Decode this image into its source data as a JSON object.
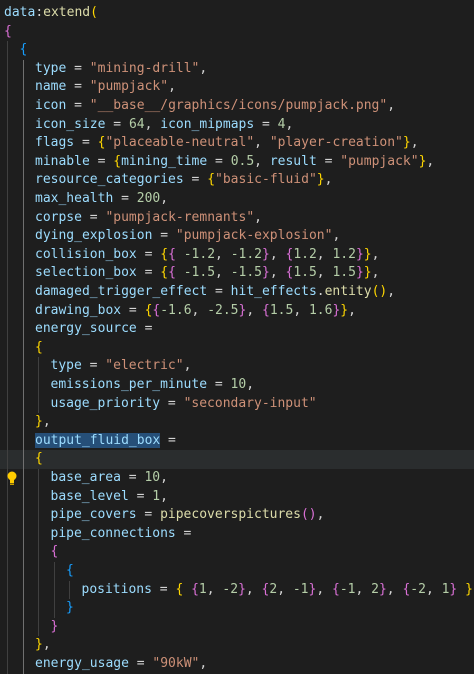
{
  "editor": {
    "theme": {
      "background": "#1e1e1e",
      "fn": "#dcdcaa",
      "var": "#9cdcfe",
      "str": "#ce9178",
      "num": "#b5cea8",
      "gold": "#ffd700",
      "pink": "#da70d6",
      "blue": "#179fff"
    },
    "highlighted_line": 24,
    "selected_word": "output_fluid_box",
    "lightbulb_line": 25,
    "lines": [
      {
        "indent": 0,
        "tokens": [
          [
            "var",
            "data"
          ],
          [
            "op",
            ":"
          ],
          [
            "fn",
            "extend"
          ],
          [
            "b1",
            "("
          ]
        ]
      },
      {
        "indent": 0,
        "tokens": [
          [
            "b2",
            "{"
          ]
        ]
      },
      {
        "indent": 1,
        "tokens": [
          [
            "b3",
            "{"
          ]
        ]
      },
      {
        "indent": 2,
        "tokens": [
          [
            "var",
            "type"
          ],
          [
            "op",
            " = "
          ],
          [
            "str",
            "\"mining-drill\""
          ],
          [
            "op",
            ","
          ]
        ]
      },
      {
        "indent": 2,
        "tokens": [
          [
            "var",
            "name"
          ],
          [
            "op",
            " = "
          ],
          [
            "str",
            "\"pumpjack\""
          ],
          [
            "op",
            ","
          ]
        ]
      },
      {
        "indent": 2,
        "tokens": [
          [
            "var",
            "icon"
          ],
          [
            "op",
            " = "
          ],
          [
            "str",
            "\"__base__/graphics/icons/pumpjack.png\""
          ],
          [
            "op",
            ","
          ]
        ]
      },
      {
        "indent": 2,
        "tokens": [
          [
            "var",
            "icon_size"
          ],
          [
            "op",
            " = "
          ],
          [
            "num",
            "64"
          ],
          [
            "op",
            ", "
          ],
          [
            "var",
            "icon_mipmaps"
          ],
          [
            "op",
            " = "
          ],
          [
            "num",
            "4"
          ],
          [
            "op",
            ","
          ]
        ]
      },
      {
        "indent": 2,
        "tokens": [
          [
            "var",
            "flags"
          ],
          [
            "op",
            " = "
          ],
          [
            "b1",
            "{"
          ],
          [
            "str",
            "\"placeable-neutral\""
          ],
          [
            "op",
            ", "
          ],
          [
            "str",
            "\"player-creation\""
          ],
          [
            "b1",
            "}"
          ],
          [
            "op",
            ","
          ]
        ]
      },
      {
        "indent": 2,
        "tokens": [
          [
            "var",
            "minable"
          ],
          [
            "op",
            " = "
          ],
          [
            "b1",
            "{"
          ],
          [
            "var",
            "mining_time"
          ],
          [
            "op",
            " = "
          ],
          [
            "num",
            "0.5"
          ],
          [
            "op",
            ", "
          ],
          [
            "var",
            "result"
          ],
          [
            "op",
            " = "
          ],
          [
            "str",
            "\"pumpjack\""
          ],
          [
            "b1",
            "}"
          ],
          [
            "op",
            ","
          ]
        ]
      },
      {
        "indent": 2,
        "tokens": [
          [
            "var",
            "resource_categories"
          ],
          [
            "op",
            " = "
          ],
          [
            "b1",
            "{"
          ],
          [
            "str",
            "\"basic-fluid\""
          ],
          [
            "b1",
            "}"
          ],
          [
            "op",
            ","
          ]
        ]
      },
      {
        "indent": 2,
        "tokens": [
          [
            "var",
            "max_health"
          ],
          [
            "op",
            " = "
          ],
          [
            "num",
            "200"
          ],
          [
            "op",
            ","
          ]
        ]
      },
      {
        "indent": 2,
        "tokens": [
          [
            "var",
            "corpse"
          ],
          [
            "op",
            " = "
          ],
          [
            "str",
            "\"pumpjack-remnants\""
          ],
          [
            "op",
            ","
          ]
        ]
      },
      {
        "indent": 2,
        "tokens": [
          [
            "var",
            "dying_explosion"
          ],
          [
            "op",
            " = "
          ],
          [
            "str",
            "\"pumpjack-explosion\""
          ],
          [
            "op",
            ","
          ]
        ]
      },
      {
        "indent": 2,
        "tokens": [
          [
            "var",
            "collision_box"
          ],
          [
            "op",
            " = "
          ],
          [
            "b1",
            "{"
          ],
          [
            "b2",
            "{"
          ],
          [
            "op",
            " "
          ],
          [
            "num",
            "-1.2"
          ],
          [
            "op",
            ", "
          ],
          [
            "num",
            "-1.2"
          ],
          [
            "b2",
            "}"
          ],
          [
            "op",
            ", "
          ],
          [
            "b2",
            "{"
          ],
          [
            "num",
            "1.2"
          ],
          [
            "op",
            ", "
          ],
          [
            "num",
            "1.2"
          ],
          [
            "b2",
            "}"
          ],
          [
            "b1",
            "}"
          ],
          [
            "op",
            ","
          ]
        ]
      },
      {
        "indent": 2,
        "tokens": [
          [
            "var",
            "selection_box"
          ],
          [
            "op",
            " = "
          ],
          [
            "b1",
            "{"
          ],
          [
            "b2",
            "{"
          ],
          [
            "op",
            " "
          ],
          [
            "num",
            "-1.5"
          ],
          [
            "op",
            ", "
          ],
          [
            "num",
            "-1.5"
          ],
          [
            "b2",
            "}"
          ],
          [
            "op",
            ", "
          ],
          [
            "b2",
            "{"
          ],
          [
            "num",
            "1.5"
          ],
          [
            "op",
            ", "
          ],
          [
            "num",
            "1.5"
          ],
          [
            "b2",
            "}"
          ],
          [
            "b1",
            "}"
          ],
          [
            "op",
            ","
          ]
        ]
      },
      {
        "indent": 2,
        "tokens": [
          [
            "var",
            "damaged_trigger_effect"
          ],
          [
            "op",
            " = "
          ],
          [
            "var",
            "hit_effects"
          ],
          [
            "op",
            "."
          ],
          [
            "fn",
            "entity"
          ],
          [
            "b1",
            "()"
          ],
          [
            "op",
            ","
          ]
        ]
      },
      {
        "indent": 2,
        "tokens": [
          [
            "var",
            "drawing_box"
          ],
          [
            "op",
            " = "
          ],
          [
            "b1",
            "{"
          ],
          [
            "b2",
            "{"
          ],
          [
            "num",
            "-1.6"
          ],
          [
            "op",
            ", "
          ],
          [
            "num",
            "-2.5"
          ],
          [
            "b2",
            "}"
          ],
          [
            "op",
            ", "
          ],
          [
            "b2",
            "{"
          ],
          [
            "num",
            "1.5"
          ],
          [
            "op",
            ", "
          ],
          [
            "num",
            "1.6"
          ],
          [
            "b2",
            "}"
          ],
          [
            "b1",
            "}"
          ],
          [
            "op",
            ","
          ]
        ]
      },
      {
        "indent": 2,
        "tokens": [
          [
            "var",
            "energy_source"
          ],
          [
            "op",
            " ="
          ]
        ]
      },
      {
        "indent": 2,
        "tokens": [
          [
            "b1",
            "{"
          ]
        ]
      },
      {
        "indent": 3,
        "tokens": [
          [
            "var",
            "type"
          ],
          [
            "op",
            " = "
          ],
          [
            "str",
            "\"electric\""
          ],
          [
            "op",
            ","
          ]
        ]
      },
      {
        "indent": 3,
        "tokens": [
          [
            "var",
            "emissions_per_minute"
          ],
          [
            "op",
            " = "
          ],
          [
            "num",
            "10"
          ],
          [
            "op",
            ","
          ]
        ]
      },
      {
        "indent": 3,
        "tokens": [
          [
            "var",
            "usage_priority"
          ],
          [
            "op",
            " = "
          ],
          [
            "str",
            "\"secondary-input\""
          ]
        ]
      },
      {
        "indent": 2,
        "tokens": [
          [
            "b1",
            "}"
          ],
          [
            "op",
            ","
          ]
        ]
      },
      {
        "indent": 2,
        "tokens": [
          [
            "var",
            "output_fluid_box"
          ],
          [
            "op",
            " ="
          ]
        ]
      },
      {
        "indent": 2,
        "tokens": [
          [
            "b1",
            "{"
          ]
        ]
      },
      {
        "indent": 3,
        "tokens": [
          [
            "var",
            "base_area"
          ],
          [
            "op",
            " = "
          ],
          [
            "num",
            "10"
          ],
          [
            "op",
            ","
          ]
        ]
      },
      {
        "indent": 3,
        "tokens": [
          [
            "var",
            "base_level"
          ],
          [
            "op",
            " = "
          ],
          [
            "num",
            "1"
          ],
          [
            "op",
            ","
          ]
        ]
      },
      {
        "indent": 3,
        "tokens": [
          [
            "var",
            "pipe_covers"
          ],
          [
            "op",
            " = "
          ],
          [
            "fn",
            "pipecoverspictures"
          ],
          [
            "b2",
            "()"
          ],
          [
            "op",
            ","
          ]
        ]
      },
      {
        "indent": 3,
        "tokens": [
          [
            "var",
            "pipe_connections"
          ],
          [
            "op",
            " ="
          ]
        ]
      },
      {
        "indent": 3,
        "tokens": [
          [
            "b2",
            "{"
          ]
        ]
      },
      {
        "indent": 4,
        "tokens": [
          [
            "b3",
            "{"
          ]
        ]
      },
      {
        "indent": 5,
        "tokens": [
          [
            "var",
            "positions"
          ],
          [
            "op",
            " = "
          ],
          [
            "b1",
            "{"
          ],
          [
            "op",
            " "
          ],
          [
            "b2",
            "{"
          ],
          [
            "num",
            "1"
          ],
          [
            "op",
            ", "
          ],
          [
            "num",
            "-2"
          ],
          [
            "b2",
            "}"
          ],
          [
            "op",
            ", "
          ],
          [
            "b2",
            "{"
          ],
          [
            "num",
            "2"
          ],
          [
            "op",
            ", "
          ],
          [
            "num",
            "-1"
          ],
          [
            "b2",
            "}"
          ],
          [
            "op",
            ", "
          ],
          [
            "b2",
            "{"
          ],
          [
            "num",
            "-1"
          ],
          [
            "op",
            ", "
          ],
          [
            "num",
            "2"
          ],
          [
            "b2",
            "}"
          ],
          [
            "op",
            ", "
          ],
          [
            "b2",
            "{"
          ],
          [
            "num",
            "-2"
          ],
          [
            "op",
            ", "
          ],
          [
            "num",
            "1"
          ],
          [
            "b2",
            "}"
          ],
          [
            "op",
            " "
          ],
          [
            "b1",
            "}"
          ]
        ]
      },
      {
        "indent": 4,
        "tokens": [
          [
            "b3",
            "}"
          ]
        ]
      },
      {
        "indent": 3,
        "tokens": [
          [
            "b2",
            "}"
          ]
        ]
      },
      {
        "indent": 2,
        "tokens": [
          [
            "b1",
            "}"
          ],
          [
            "op",
            ","
          ]
        ]
      },
      {
        "indent": 2,
        "tokens": [
          [
            "var",
            "energy_usage"
          ],
          [
            "op",
            " = "
          ],
          [
            "str",
            "\"90kW\""
          ],
          [
            "op",
            ","
          ]
        ]
      }
    ]
  }
}
